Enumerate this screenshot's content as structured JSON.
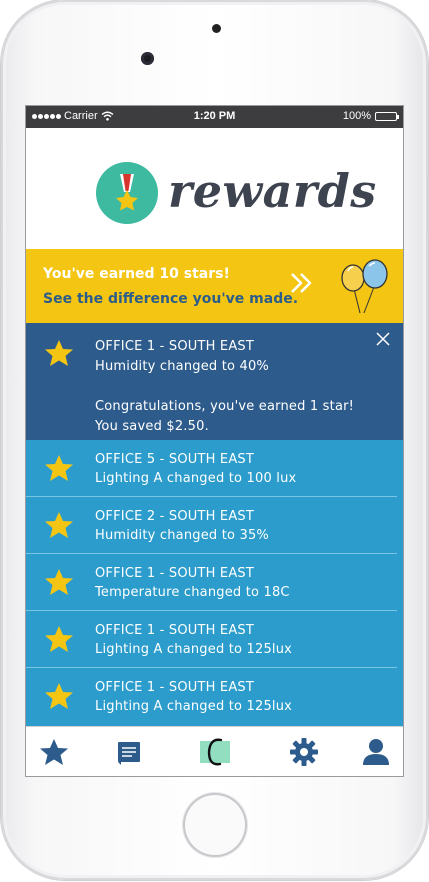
{
  "status_bar": {
    "carrier": "Carrier",
    "time": "1:20 PM",
    "battery": "100%"
  },
  "brand": {
    "title": "rewards",
    "logo_icon": "medal-star-icon",
    "accent": "#3dba9f"
  },
  "banner": {
    "line1": "You've earned 10 stars!",
    "line2": "See the difference you've made.",
    "color": "#f4c613"
  },
  "notifications": [
    {
      "office": "OFFICE 1 - SOUTH EAST",
      "change": "Humidity changed to 40%",
      "message": "Congratulations, you've earned 1 star!",
      "saved": "You saved  $2.50.",
      "expanded": true
    },
    {
      "office": "OFFICE 5 - SOUTH EAST",
      "change": "Lighting A changed to 100 lux"
    },
    {
      "office": "OFFICE 2 - SOUTH EAST",
      "change": "Humidity changed to 35%"
    },
    {
      "office": "OFFICE 1 - SOUTH EAST",
      "change": "Temperature changed to 18C"
    },
    {
      "office": "OFFICE 1 - SOUTH EAST",
      "change": "Lighting A changed to 125lux"
    },
    {
      "office": "OFFICE 1 - SOUTH EAST",
      "change": "Lighting A changed to 125lux"
    }
  ],
  "tab_bar": {
    "icons": [
      "star-icon",
      "notes-icon",
      "brand-c-icon",
      "gear-icon",
      "user-icon"
    ],
    "color": "#2d5b8b"
  }
}
